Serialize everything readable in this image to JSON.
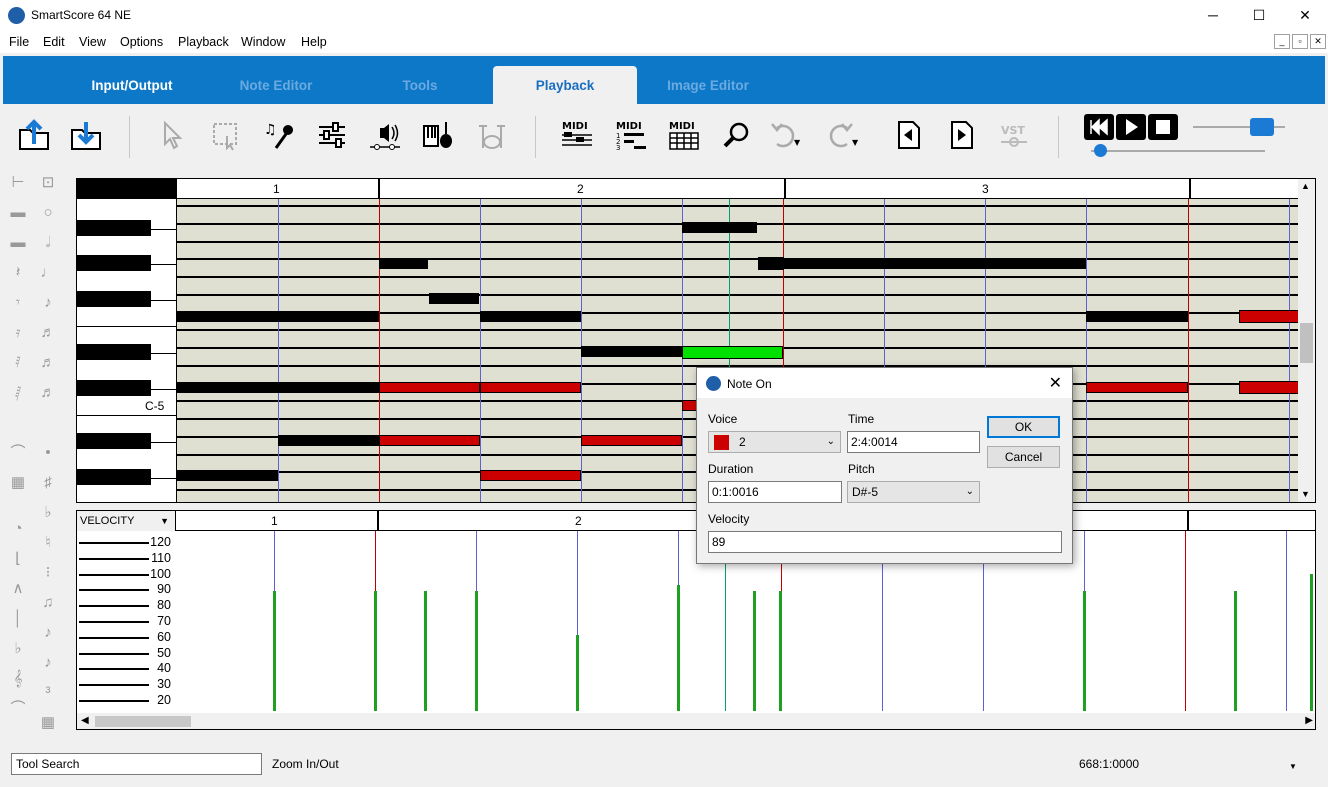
{
  "window": {
    "title": "SmartScore 64 NE",
    "minimize": "─",
    "maximize": "☐",
    "close": "✕"
  },
  "menu": [
    "File",
    "Edit",
    "View",
    "Options",
    "Playback",
    "Window",
    "Help"
  ],
  "ribbon_tabs": [
    {
      "label": "Input/Output",
      "state": "normal"
    },
    {
      "label": "Note Editor",
      "state": "dim"
    },
    {
      "label": "Tools",
      "state": "dim"
    },
    {
      "label": "Playback",
      "state": "active"
    },
    {
      "label": "Image Editor",
      "state": "dim"
    }
  ],
  "toolbar": {
    "icons": [
      "import-icon",
      "export-icon",
      "select-arrow-icon",
      "marquee-select-icon",
      "voice-record-icon",
      "mixer-icon",
      "audio-output-icon",
      "instruments-icon",
      "drums-icon",
      "midi-staff-icon",
      "midi-numbered-icon",
      "midi-grid-icon",
      "zoom-icon",
      "undo-icon",
      "redo-icon",
      "prev-page-icon",
      "next-page-icon",
      "vst-icon"
    ],
    "midi_label": "MIDI",
    "vst_label": "VST"
  },
  "transport": {
    "rewind": "rewind-icon",
    "play": "play-icon",
    "stop": "stop-icon",
    "tempo_level": 0.75,
    "position_level": 0.05
  },
  "piano_roll": {
    "measures": [
      "1",
      "2",
      "3"
    ],
    "key_label": "C-5"
  },
  "velocity": {
    "selector": "VELOCITY",
    "measures": [
      "1",
      "2"
    ],
    "axis_labels": [
      "120",
      "110",
      "100",
      "90",
      "80",
      "70",
      "60",
      "50",
      "40",
      "30",
      "20"
    ],
    "bars": [
      89,
      89,
      89,
      89,
      61,
      93,
      89,
      89,
      89,
      89,
      100
    ]
  },
  "dialog": {
    "title": "Note On",
    "voice_label": "Voice",
    "voice_value": "2",
    "voice_color": "#cc0000",
    "time_label": "Time",
    "time_value": "2:4:0014",
    "duration_label": "Duration",
    "duration_value": "0:1:0016",
    "pitch_label": "Pitch",
    "pitch_value": "D#-5",
    "velocity_label": "Velocity",
    "velocity_value": "89",
    "ok": "OK",
    "cancel": "Cancel"
  },
  "status": {
    "tool_search": "Tool Search",
    "zoom": "Zoom In/Out",
    "position": "668:1:0000"
  }
}
